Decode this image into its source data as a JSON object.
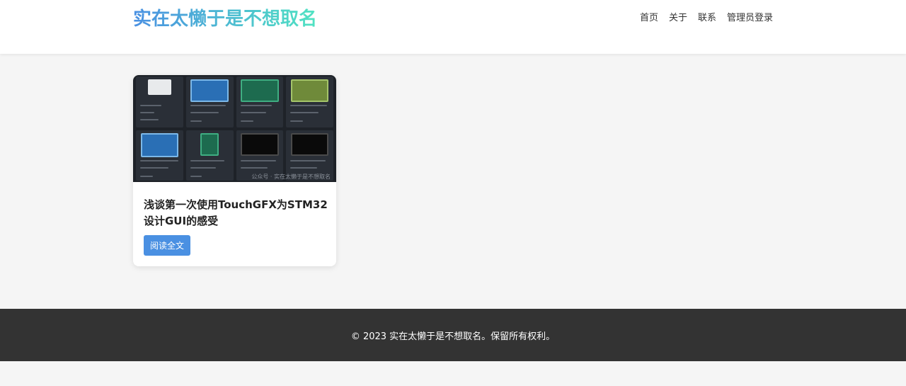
{
  "header": {
    "logo": "实在太懒于是不想取名",
    "nav": [
      "首页",
      "关于",
      "联系",
      "管理员登录"
    ]
  },
  "post": {
    "title": "浅谈第一次使用TouchGFX为STM32设计GUI的感受",
    "read_more": "阅读全文",
    "thumbnail_watermark": "公众号 · 实在太懒于是不想取名"
  },
  "footer": {
    "text": "© 2023 实在太懒于是不想取名。保留所有权利。"
  },
  "colors": {
    "accent": "#4a90e2",
    "logo_gradient_end": "#50e3c2",
    "footer_bg": "#333333"
  }
}
